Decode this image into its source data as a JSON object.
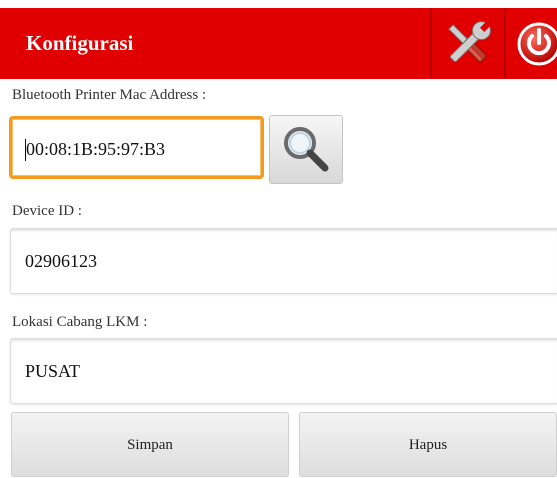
{
  "header": {
    "title": "Konfigurasi",
    "bar_color": "#e10000",
    "icons": [
      "tools-icon",
      "power-icon"
    ]
  },
  "form": {
    "mac_label": "Bluetooth Printer Mac Address :",
    "mac_value": "00:08:1B:95:97:B3",
    "device_label": "Device ID :",
    "device_value": "02906123",
    "branch_label": "Lokasi Cabang LKM :",
    "branch_value": "PUSAT"
  },
  "buttons": {
    "save_label": "Simpan",
    "delete_label": "Hapus"
  },
  "colors": {
    "accent": "#e10000",
    "focus_border": "#f39a1f"
  }
}
